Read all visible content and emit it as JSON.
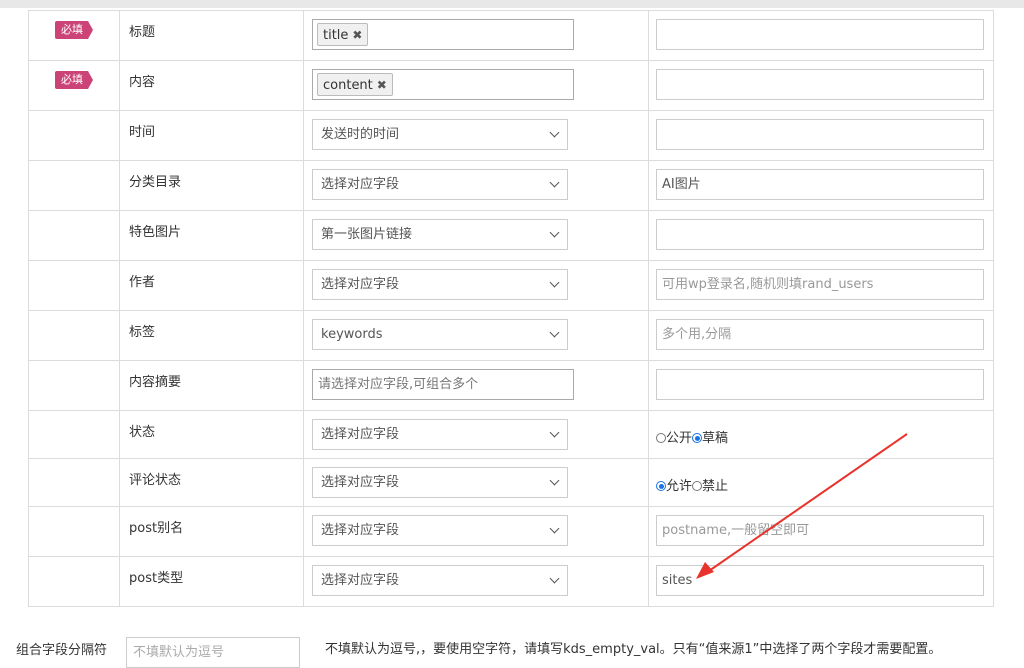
{
  "required_badge": "必填",
  "rows": [
    {
      "label": "标题",
      "type": "tags",
      "tag": "title",
      "right": {
        "kind": "input",
        "value": "",
        "placeholder": ""
      },
      "required": true
    },
    {
      "label": "内容",
      "type": "tags",
      "tag": "content",
      "right": {
        "kind": "input",
        "value": "",
        "placeholder": ""
      },
      "required": true
    },
    {
      "label": "时间",
      "type": "select",
      "select": "发送时的时间",
      "right": {
        "kind": "input",
        "value": "",
        "placeholder": ""
      }
    },
    {
      "label": "分类目录",
      "type": "select",
      "select": "选择对应字段",
      "right": {
        "kind": "input",
        "value": "AI图片",
        "placeholder": ""
      }
    },
    {
      "label": "特色图片",
      "type": "select",
      "select": "第一张图片链接",
      "right": {
        "kind": "input",
        "value": "",
        "placeholder": ""
      }
    },
    {
      "label": "作者",
      "type": "select",
      "select": "选择对应字段",
      "right": {
        "kind": "input",
        "value": "",
        "placeholder": "可用wp登录名,随机则填rand_users"
      }
    },
    {
      "label": "标签",
      "type": "select",
      "select": "keywords",
      "right": {
        "kind": "input",
        "value": "",
        "placeholder": "多个用,分隔"
      }
    },
    {
      "label": "内容摘要",
      "type": "multi",
      "placeholder": "请选择对应字段,可组合多个",
      "right": {
        "kind": "input",
        "value": "",
        "placeholder": ""
      }
    },
    {
      "label": "状态",
      "type": "select",
      "select": "选择对应字段",
      "right": {
        "kind": "radios",
        "options": [
          {
            "label": "公开",
            "checked": false
          },
          {
            "label": "草稿",
            "checked": true
          }
        ]
      }
    },
    {
      "label": "评论状态",
      "type": "select",
      "select": "选择对应字段",
      "right": {
        "kind": "radios",
        "options": [
          {
            "label": "允许",
            "checked": true
          },
          {
            "label": "禁止",
            "checked": false
          }
        ]
      }
    },
    {
      "label": "post别名",
      "type": "select",
      "select": "选择对应字段",
      "right": {
        "kind": "input",
        "value": "",
        "placeholder": "postname,一般留空即可"
      }
    },
    {
      "label": "post类型",
      "type": "select",
      "select": "选择对应字段",
      "right": {
        "kind": "input",
        "value": "sites",
        "placeholder": ""
      }
    }
  ],
  "bottom": {
    "label": "组合字段分隔符",
    "input_placeholder": "不填默认为逗号",
    "note": "不填默认为逗号,，要使用空字符，请填写kds_empty_val。只有“值来源1”中选择了两个字段才需要配置。"
  },
  "annotation_color": "#e8322b",
  "accent_color": "#cc4477"
}
